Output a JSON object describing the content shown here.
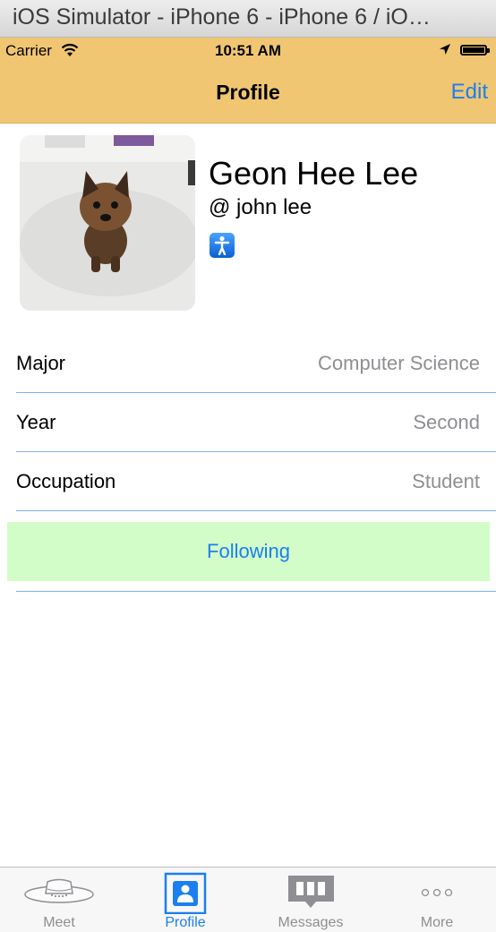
{
  "window": {
    "title": "iOS Simulator - iPhone 6 - iPhone 6 / iO…"
  },
  "status_bar": {
    "carrier": "Carrier",
    "time": "10:51 AM"
  },
  "nav": {
    "title": "Profile",
    "edit_label": "Edit",
    "background": "#f0c672"
  },
  "profile": {
    "name": "Geon Hee Lee",
    "handle": "@ john lee"
  },
  "details": [
    {
      "label": "Major",
      "value": "Computer Science"
    },
    {
      "label": "Year",
      "value": "Second"
    },
    {
      "label": "Occupation",
      "value": "Student"
    }
  ],
  "follow_button": {
    "label": "Following",
    "background": "#d3fdc8"
  },
  "accent_color": "#1a7ff0",
  "tabs": [
    {
      "label": "Meet",
      "icon": "hat-icon",
      "active": false
    },
    {
      "label": "Profile",
      "icon": "person-icon",
      "active": true
    },
    {
      "label": "Messages",
      "icon": "messages-icon",
      "active": false
    },
    {
      "label": "More",
      "icon": "more-dots-icon",
      "active": false
    }
  ]
}
